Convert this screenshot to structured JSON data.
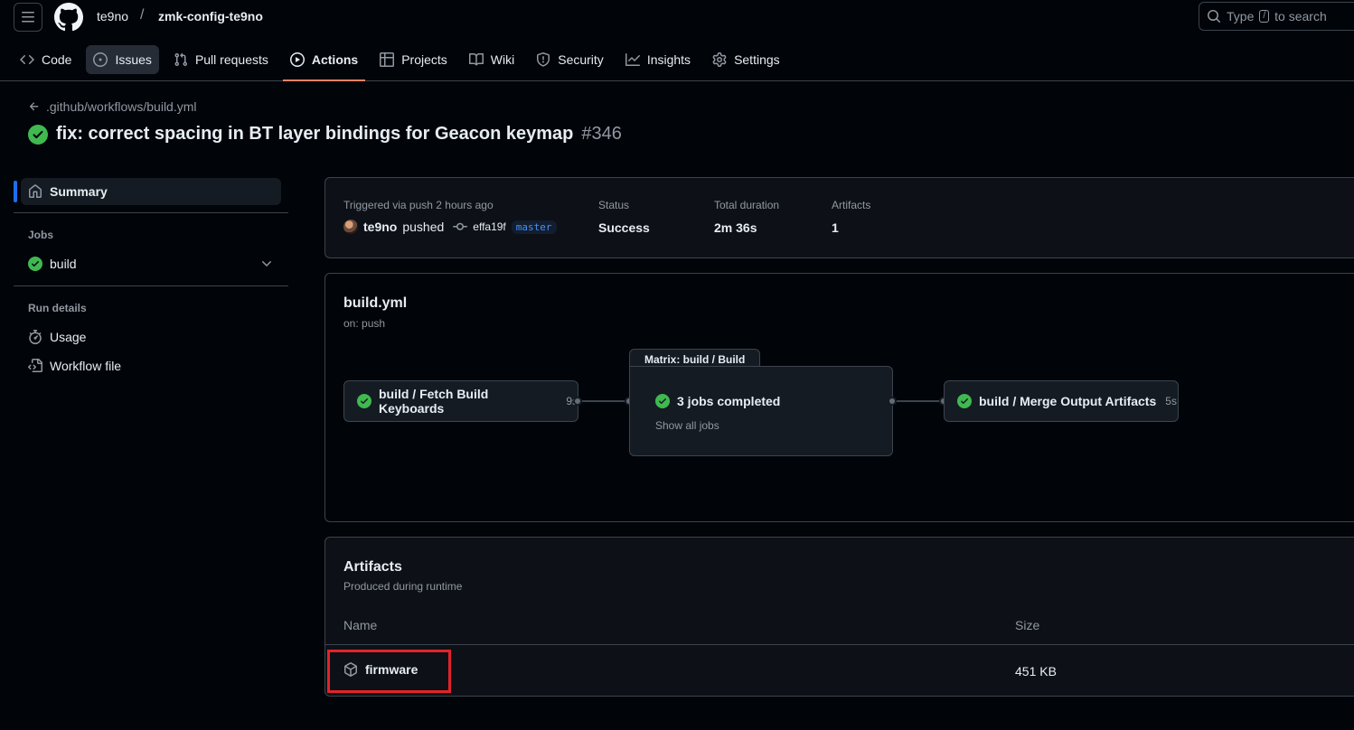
{
  "header": {
    "owner": "te9no",
    "separator": "/",
    "repo": "zmk-config-te9no",
    "search_prefix": "Type",
    "search_key": "/",
    "search_suffix": "to search"
  },
  "tabs": [
    {
      "label": "Code",
      "icon": "code-icon"
    },
    {
      "label": "Issues",
      "icon": "issue-opened-icon"
    },
    {
      "label": "Pull requests",
      "icon": "git-pull-request-icon"
    },
    {
      "label": "Actions",
      "icon": "play-icon"
    },
    {
      "label": "Projects",
      "icon": "table-icon"
    },
    {
      "label": "Wiki",
      "icon": "book-icon"
    },
    {
      "label": "Security",
      "icon": "shield-icon"
    },
    {
      "label": "Insights",
      "icon": "graph-icon"
    },
    {
      "label": "Settings",
      "icon": "gear-icon"
    }
  ],
  "back_link": ".github/workflows/build.yml",
  "run": {
    "title": "fix: correct spacing in BT layer bindings for Geacon keymap",
    "number": "#346"
  },
  "sidebar": {
    "summary": "Summary",
    "jobs_heading": "Jobs",
    "job_build": "build",
    "run_details_heading": "Run details",
    "usage": "Usage",
    "workflow_file": "Workflow file"
  },
  "run_info": {
    "triggered": "Triggered via push 2 hours ago",
    "user": "te9no",
    "action": "pushed",
    "commit": "effa19f",
    "branch": "master",
    "status_label": "Status",
    "status_value": "Success",
    "duration_label": "Total duration",
    "duration_value": "2m 36s",
    "artifacts_label": "Artifacts",
    "artifacts_value": "1"
  },
  "graph": {
    "title": "build.yml",
    "trigger": "on: push",
    "job1_name": "build / Fetch Build Keyboards",
    "job1_dur": "9s",
    "matrix_label": "Matrix: build / Build",
    "matrix_status": "3 jobs completed",
    "matrix_link": "Show all jobs",
    "job3_name": "build / Merge Output Artifacts",
    "job3_dur": "5s"
  },
  "artifacts": {
    "title": "Artifacts",
    "subtitle": "Produced during runtime",
    "col_name": "Name",
    "col_size": "Size",
    "rows": [
      {
        "name": "firmware",
        "size": "451 KB"
      }
    ]
  },
  "colors": {
    "success": "#3fb950",
    "accent_underline": "#f78166",
    "highlight": "#e3232a",
    "link_blue": "#4493f8"
  }
}
